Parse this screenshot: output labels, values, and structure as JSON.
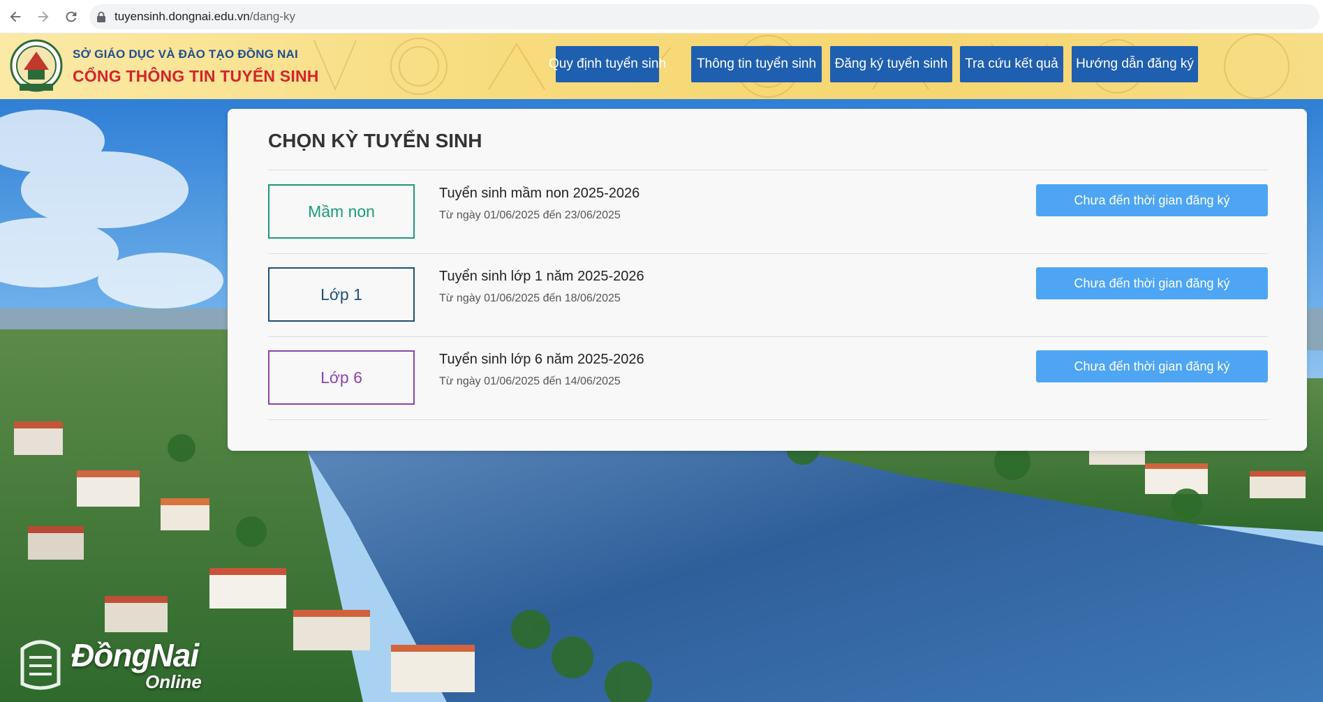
{
  "browser": {
    "url_domain": "tuyensinh.dongnai.edu.vn",
    "url_path": "/dang-ky"
  },
  "header": {
    "brand_line1": "SỞ GIÁO DỤC VÀ ĐÀO TẠO ĐỒNG NAI",
    "brand_line2": "CỔNG THÔNG TIN TUYỂN SINH",
    "nav": [
      {
        "label": "Quy định tuyển sinh"
      },
      {
        "label": "Thông tin tuyển sinh"
      },
      {
        "label": "Đăng ký tuyển sinh"
      },
      {
        "label": "Tra cứu kết quả"
      },
      {
        "label": "Hướng dẫn đăng ký"
      }
    ]
  },
  "card": {
    "title": "CHỌN KỲ TUYỂN SINH",
    "rows": [
      {
        "level": "Mầm non",
        "title": "Tuyển sinh mầm non 2025-2026",
        "date": "Từ ngày 01/06/2025 đến 23/06/2025",
        "status": "Chưa đến thời gian đăng ký",
        "color": "#1a9b7a"
      },
      {
        "level": "Lớp 1",
        "title": "Tuyển sinh lớp 1 năm 2025-2026",
        "date": "Từ ngày 01/06/2025 đến 18/06/2025",
        "status": "Chưa đến thời gian đăng ký",
        "color": "#1e4f7a"
      },
      {
        "level": "Lớp 6",
        "title": "Tuyển sinh lớp 6 năm 2025-2026",
        "date": "Từ ngày 01/06/2025 đến 14/06/2025",
        "status": "Chưa đến thời gian đăng ký",
        "color": "#8e44ad"
      }
    ]
  },
  "watermark": {
    "main": "ĐồngNai",
    "sub": "Online"
  },
  "colors": {
    "nav_bg": "#1f5fb0",
    "status_button": "#4ea5f3",
    "brand_blue": "#1d4f91",
    "brand_red": "#d3232b"
  }
}
